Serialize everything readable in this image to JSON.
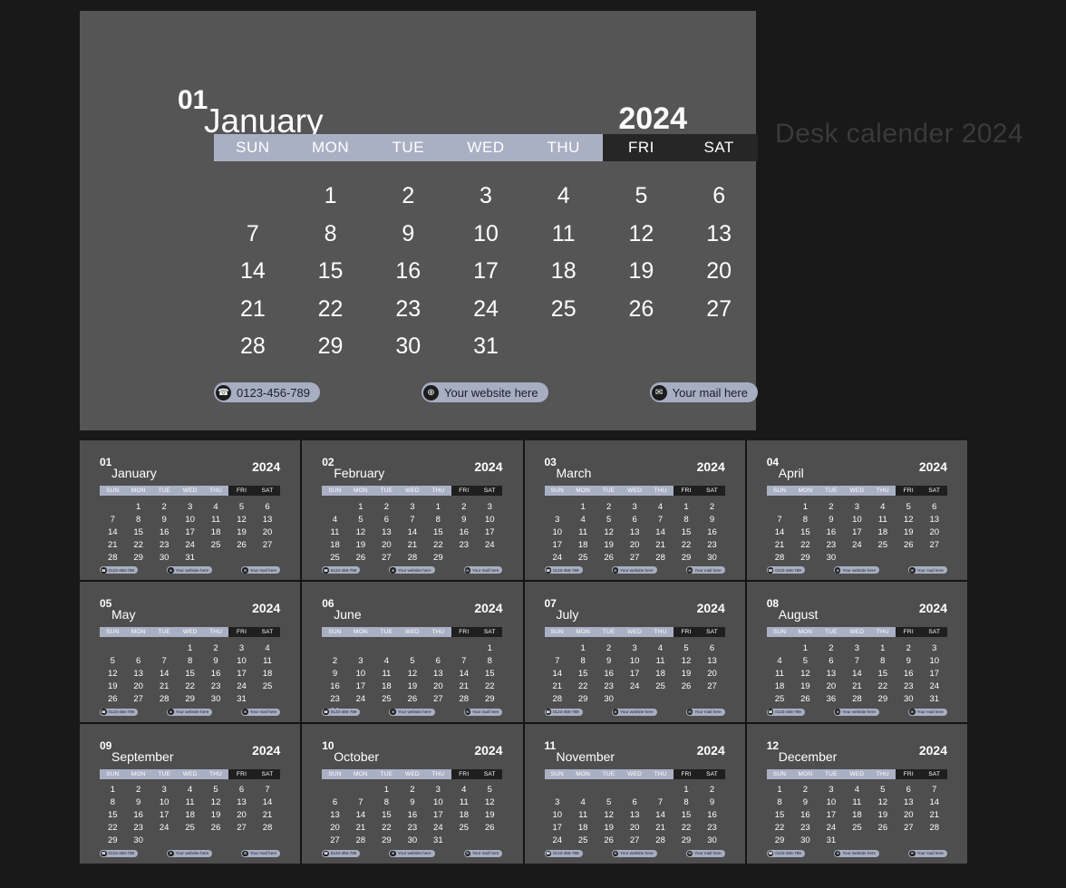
{
  "watermark": "Desk calender 2024",
  "year": "2024",
  "weekdays": [
    "SUN",
    "MON",
    "TUE",
    "WED",
    "THU",
    "FRI",
    "SAT"
  ],
  "weekend_start_index": 5,
  "contacts": [
    {
      "icon": "phone-icon",
      "glyph": "☎",
      "label": "0123-456-789"
    },
    {
      "icon": "globe-icon",
      "glyph": "ἱ0",
      "label": "Your website here"
    },
    {
      "icon": "mail-icon",
      "glyph": "✉",
      "label": "Your mail here"
    }
  ],
  "colors": {
    "page_background": "#191919",
    "panel": "#555555",
    "card": "#4e4e4e",
    "board": "#141414",
    "weekday_bar": "#aab0c4",
    "weekend_bar": "#262626",
    "text": "#ffffff",
    "watermark": "#3a3a3a",
    "pill": "#a8aec2"
  },
  "hero": {
    "number": "01",
    "name": "January",
    "year": "2024",
    "days": [
      "",
      "1",
      "2",
      "3",
      "4",
      "5",
      "6",
      "7",
      "8",
      "9",
      "10",
      "11",
      "12",
      "13",
      "14",
      "15",
      "16",
      "17",
      "18",
      "19",
      "20",
      "21",
      "22",
      "23",
      "24",
      "25",
      "26",
      "27",
      "28",
      "29",
      "30",
      "31",
      "",
      "",
      ""
    ]
  },
  "months": [
    {
      "number": "01",
      "name": "January",
      "year": "2024",
      "days": [
        "",
        "1",
        "2",
        "3",
        "4",
        "5",
        "6",
        "7",
        "8",
        "9",
        "10",
        "11",
        "12",
        "13",
        "14",
        "15",
        "16",
        "17",
        "18",
        "19",
        "20",
        "21",
        "22",
        "23",
        "24",
        "25",
        "26",
        "27",
        "28",
        "29",
        "30",
        "31",
        "",
        "",
        ""
      ]
    },
    {
      "number": "02",
      "name": "February",
      "year": "2024",
      "days": [
        "",
        "1",
        "2",
        "3",
        "1",
        "2",
        "3",
        "4",
        "5",
        "6",
        "7",
        "8",
        "9",
        "10",
        "11",
        "12",
        "13",
        "14",
        "15",
        "16",
        "17",
        "18",
        "19",
        "20",
        "21",
        "22",
        "23",
        "24",
        "25",
        "26",
        "27",
        "28",
        "29",
        "",
        ""
      ]
    },
    {
      "number": "03",
      "name": "March",
      "year": "2024",
      "days": [
        "",
        "1",
        "2",
        "3",
        "4",
        "1",
        "2",
        "3",
        "4",
        "5",
        "6",
        "7",
        "8",
        "9",
        "10",
        "11",
        "12",
        "13",
        "14",
        "15",
        "16",
        "17",
        "18",
        "19",
        "20",
        "21",
        "22",
        "23",
        "24",
        "25",
        "26",
        "27",
        "28",
        "29",
        "30",
        "31",
        "",
        "",
        "",
        "",
        "",
        ""
      ]
    },
    {
      "number": "04",
      "name": "April",
      "year": "2024",
      "days": [
        "",
        "1",
        "2",
        "3",
        "4",
        "5",
        "6",
        "7",
        "8",
        "9",
        "10",
        "11",
        "12",
        "13",
        "14",
        "15",
        "16",
        "17",
        "18",
        "19",
        "20",
        "21",
        "22",
        "23",
        "24",
        "25",
        "26",
        "27",
        "28",
        "29",
        "30",
        "",
        "",
        "",
        ""
      ]
    },
    {
      "number": "05",
      "name": "May",
      "year": "2024",
      "days": [
        "",
        "",
        "",
        "1",
        "2",
        "3",
        "4",
        "5",
        "6",
        "7",
        "8",
        "9",
        "10",
        "11",
        "12",
        "13",
        "14",
        "15",
        "16",
        "17",
        "18",
        "19",
        "20",
        "21",
        "22",
        "23",
        "24",
        "25",
        "26",
        "27",
        "28",
        "29",
        "30",
        "31",
        ""
      ]
    },
    {
      "number": "06",
      "name": "June",
      "year": "2024",
      "days": [
        "",
        "",
        "",
        "",
        "",
        "",
        "1",
        "2",
        "3",
        "4",
        "5",
        "6",
        "7",
        "8",
        "9",
        "10",
        "11",
        "12",
        "13",
        "14",
        "15",
        "16",
        "17",
        "18",
        "19",
        "20",
        "21",
        "22",
        "23",
        "24",
        "25",
        "26",
        "27",
        "28",
        "29",
        "30",
        "",
        "",
        "",
        "",
        "",
        ""
      ]
    },
    {
      "number": "07",
      "name": "July",
      "year": "2024",
      "days": [
        "",
        "1",
        "2",
        "3",
        "4",
        "5",
        "6",
        "7",
        "8",
        "9",
        "10",
        "11",
        "12",
        "13",
        "14",
        "15",
        "16",
        "17",
        "18",
        "19",
        "20",
        "21",
        "22",
        "23",
        "24",
        "25",
        "26",
        "27",
        "28",
        "29",
        "30",
        "",
        "",
        "",
        ""
      ]
    },
    {
      "number": "08",
      "name": "August",
      "year": "2024",
      "days": [
        "",
        "1",
        "2",
        "3",
        "1",
        "2",
        "3",
        "4",
        "5",
        "6",
        "7",
        "8",
        "9",
        "10",
        "11",
        "12",
        "13",
        "14",
        "15",
        "16",
        "17",
        "18",
        "19",
        "20",
        "21",
        "22",
        "23",
        "24",
        "25",
        "26",
        "36",
        "28",
        "29",
        "30",
        "31"
      ]
    },
    {
      "number": "09",
      "name": "September",
      "year": "2024",
      "days": [
        "1",
        "2",
        "3",
        "4",
        "5",
        "6",
        "7",
        "8",
        "9",
        "10",
        "11",
        "12",
        "13",
        "14",
        "15",
        "16",
        "17",
        "18",
        "19",
        "20",
        "21",
        "22",
        "23",
        "24",
        "25",
        "26",
        "27",
        "28",
        "29",
        "30",
        "",
        "",
        "",
        "",
        ""
      ]
    },
    {
      "number": "10",
      "name": "October",
      "year": "2024",
      "days": [
        "",
        "",
        "1",
        "2",
        "3",
        "4",
        "5",
        "6",
        "7",
        "8",
        "9",
        "10",
        "11",
        "12",
        "13",
        "14",
        "15",
        "16",
        "17",
        "18",
        "19",
        "20",
        "21",
        "22",
        "23",
        "24",
        "25",
        "26",
        "27",
        "28",
        "29",
        "30",
        "31",
        "",
        ""
      ]
    },
    {
      "number": "11",
      "name": "November",
      "year": "2024",
      "days": [
        "",
        "",
        "",
        "",
        "",
        "1",
        "2",
        "3",
        "4",
        "5",
        "6",
        "7",
        "8",
        "9",
        "10",
        "11",
        "12",
        "13",
        "14",
        "15",
        "16",
        "17",
        "18",
        "19",
        "20",
        "21",
        "22",
        "23",
        "24",
        "25",
        "26",
        "27",
        "28",
        "29",
        "30"
      ]
    },
    {
      "number": "12",
      "name": "December",
      "year": "2024",
      "days": [
        "1",
        "2",
        "3",
        "4",
        "5",
        "6",
        "7",
        "8",
        "9",
        "10",
        "11",
        "12",
        "13",
        "14",
        "15",
        "16",
        "17",
        "18",
        "19",
        "20",
        "21",
        "22",
        "23",
        "24",
        "25",
        "26",
        "27",
        "28",
        "29",
        "30",
        "31",
        "",
        "",
        "",
        ""
      ]
    }
  ]
}
